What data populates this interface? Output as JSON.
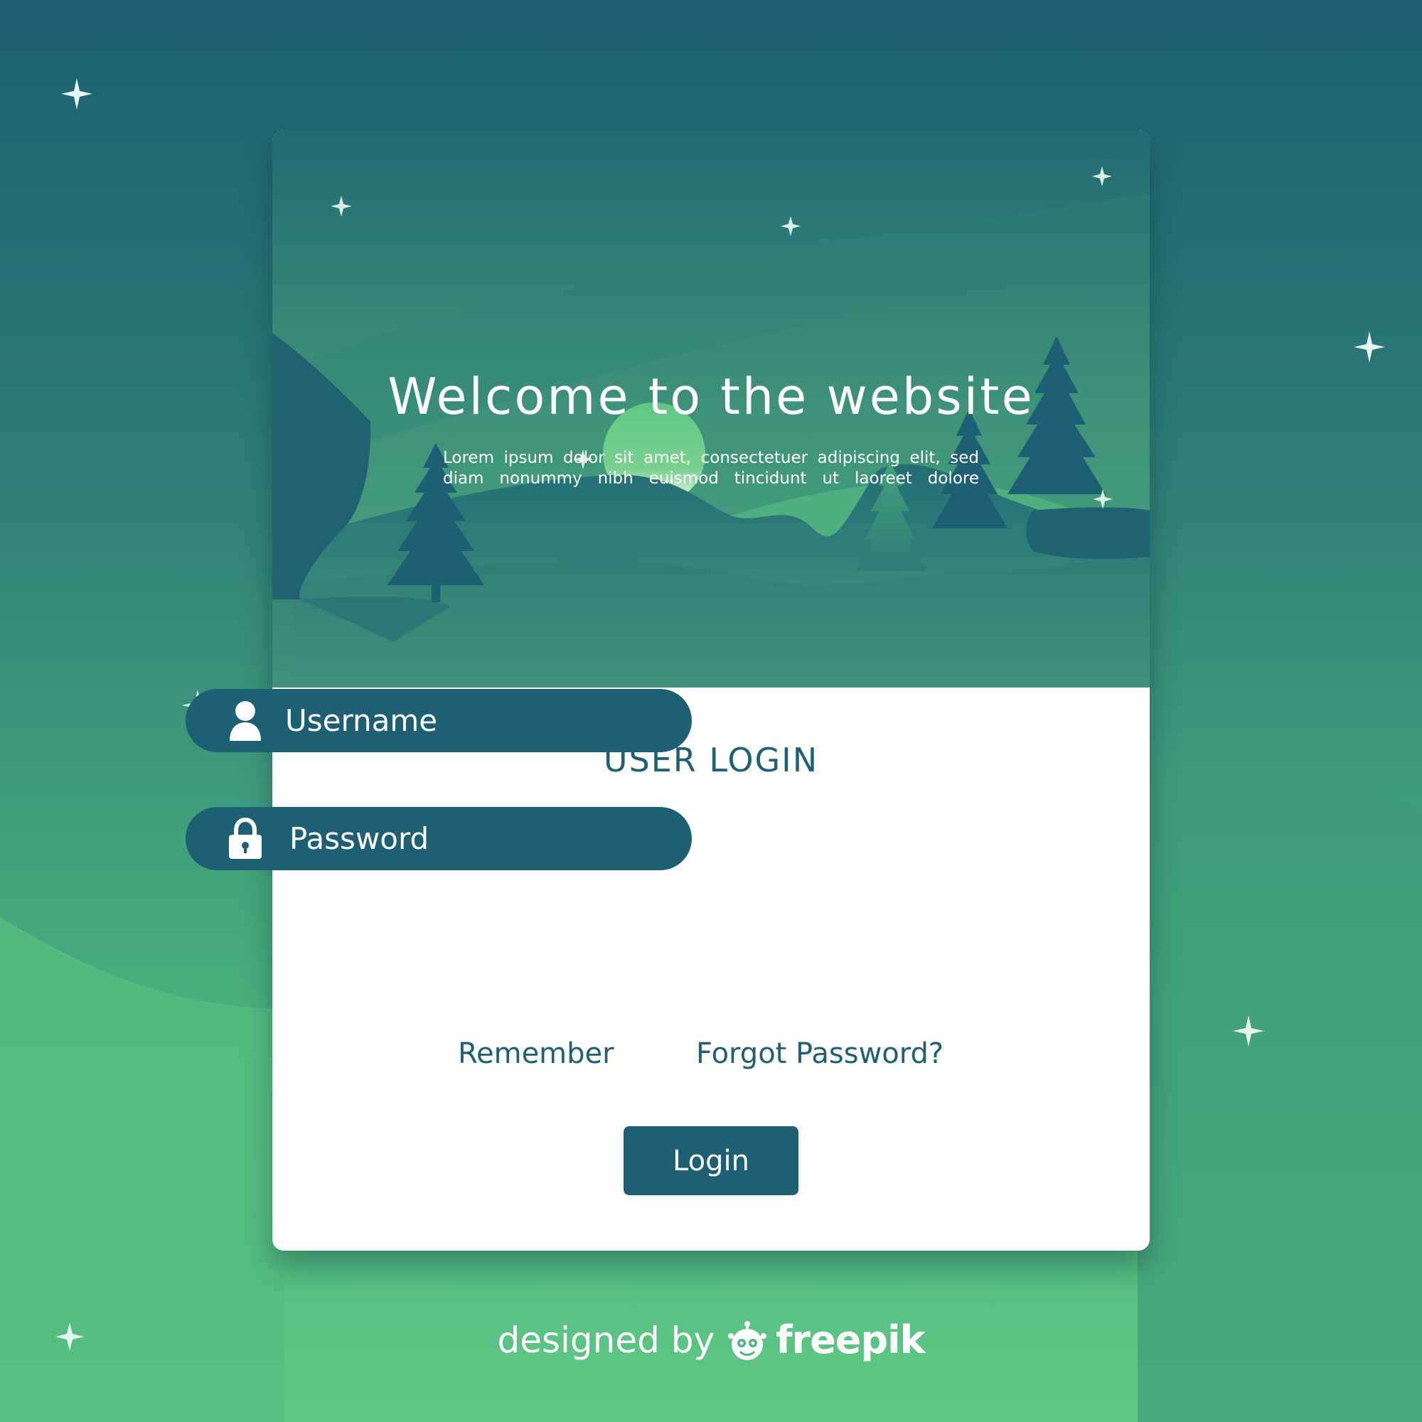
{
  "hero": {
    "title": "Welcome to the website",
    "subtitle": "Lorem ipsum dolor sit amet, consectetuer adipiscing elit, sed diam nonummy nibh euismod tincidunt ut laoreet dolore"
  },
  "login": {
    "heading": "USER LOGIN",
    "username_placeholder": "Username",
    "password_placeholder": "Password",
    "remember_label": "Remember",
    "forgot_label": "Forgot Password?",
    "button_label": "Login"
  },
  "icons": {
    "username": "user-icon",
    "password": "lock-icon",
    "brand": "freepik-logo-icon"
  },
  "credit": {
    "prefix": "designed by",
    "brand": "freepik"
  },
  "colors": {
    "primary": "#1d5f73",
    "background_top": "#1c5f72",
    "background_bottom": "#5ec883",
    "card": "#ffffff",
    "hero_green": "#5cc681"
  }
}
